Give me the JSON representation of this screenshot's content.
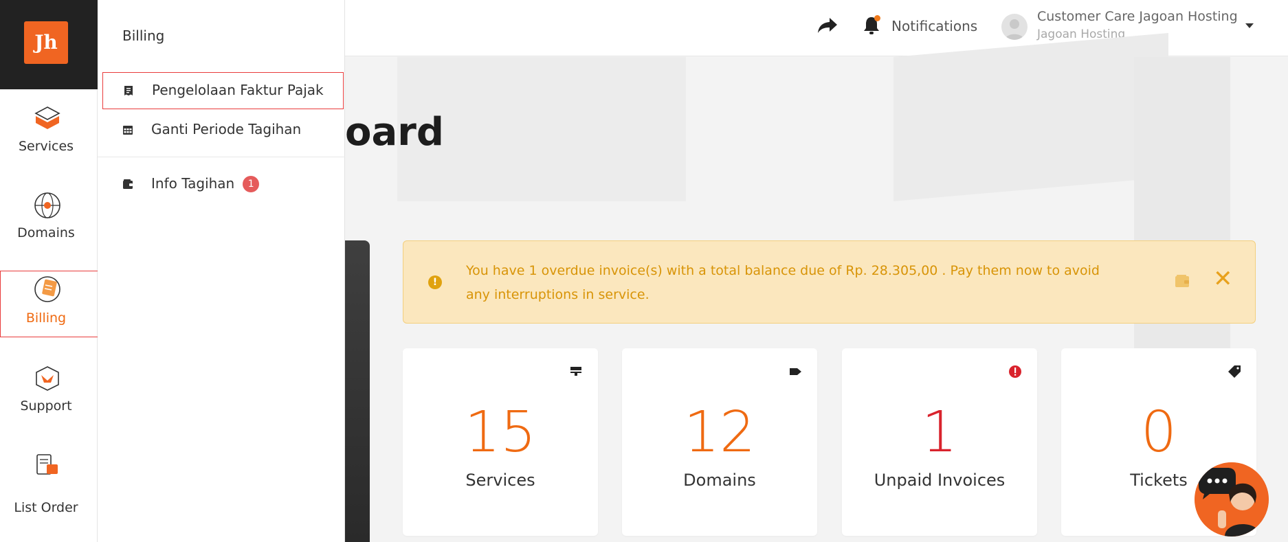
{
  "header": {
    "notifications_label": "Notifications",
    "user_name": "Customer Care Jagoan Hosting",
    "user_org": "Jagoan Hosting"
  },
  "page": {
    "title": "oard"
  },
  "alert": {
    "message": "You have 1 overdue invoice(s) with a total balance due of Rp. 28.305,00 . Pay them now to avoid any interruptions in service."
  },
  "stats": [
    {
      "value": "15",
      "label": "Services",
      "color": "#ef6a12",
      "icon": "server-icon"
    },
    {
      "value": "12",
      "label": "Domains",
      "color": "#ef6a12",
      "icon": "tag-icon"
    },
    {
      "value": "1",
      "label": "Unpaid Invoices",
      "color": "#d9232d",
      "icon": "alert-circle-icon"
    },
    {
      "value": "0",
      "label": "Tickets",
      "color": "#ef6a12",
      "icon": "ticket-tag-icon"
    }
  ],
  "rail": {
    "logo_text": "Jh",
    "items": [
      {
        "label": "Services",
        "icon": "box-icon"
      },
      {
        "label": "Domains",
        "icon": "globe-icon"
      },
      {
        "label": "Billing",
        "icon": "billing-icon"
      },
      {
        "label": "Support",
        "icon": "support-box-icon"
      },
      {
        "label": "List Order",
        "icon": "list-order-icon"
      }
    ]
  },
  "flyout": {
    "title": "Billing",
    "items": [
      {
        "label": "Pengelolaan Faktur Pajak",
        "icon": "receipt-icon"
      },
      {
        "label": "Ganti Periode Tagihan",
        "icon": "calendar-icon"
      },
      {
        "label": "Info Tagihan",
        "icon": "wallet-icon",
        "badge": "1"
      }
    ]
  },
  "colors": {
    "accent": "#ef6a12",
    "danger": "#d9232d",
    "alert_bg": "#fbe7be",
    "alert_text": "#d89407"
  }
}
